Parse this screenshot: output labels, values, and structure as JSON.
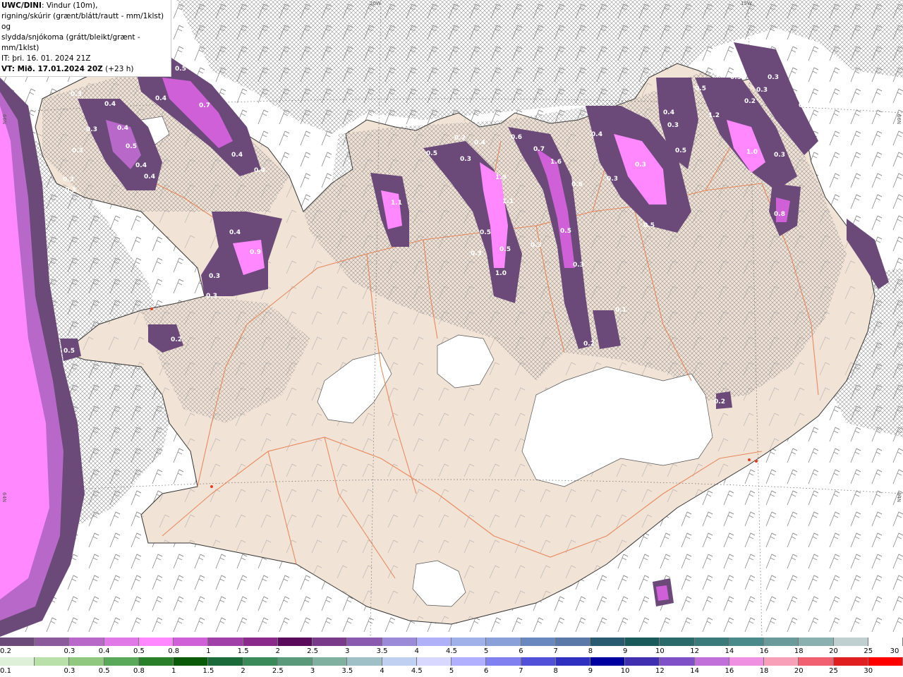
{
  "header": {
    "title_bold": "UWC/DINI",
    "title_rest": ": Vindur (10m),",
    "line2": "rigning/skúrir (grænt/blátt/rautt - mm/1klst) og",
    "line3": "slydda/snjókoma (grátt/bleikt/grænt - mm/1klst)",
    "line4": "IT: þri. 16. 01. 2024 21Z",
    "line5_bold": "VT: Mið. 17.01.2024 20Z",
    "line5_rest": " (+23 h)"
  },
  "grid_labels": {
    "lon_20w": "20W",
    "lon_15w": "15W",
    "lat_66n_left": "66N",
    "lat_66n_right": "66N",
    "lat_64n_left": "64N",
    "lat_64n_right": "64N"
  },
  "precip_labels": [
    "0.4",
    "0.5",
    "0.3",
    "0.4",
    "0.7",
    "0.4",
    "0.3",
    "0.4",
    "0.5",
    "0.4",
    "0.4",
    "0.3",
    "0.3",
    "0.3",
    "0.4",
    "0.4",
    "0.9",
    "0.4",
    "0.3",
    "0.2",
    "0.5",
    "1.1",
    "0.5",
    "0.2",
    "0.4",
    "0.3",
    "0.6",
    "0.7",
    "1.6",
    "1.9",
    "1.1",
    "0.5",
    "0.5",
    "1.0",
    "0.3",
    "0.3",
    "0.5",
    "0.6",
    "0.3",
    "0.4",
    "0.4",
    "0.3",
    "0.5",
    "1.2",
    "0.3",
    "0.3",
    "0.5",
    "0.2",
    "0.3",
    "1.0",
    "0.3",
    "0.3",
    "0.3",
    "0.8",
    "0.3",
    "0.3",
    "0.2",
    "0.1",
    "0.2",
    "0.5"
  ],
  "legend_snow": {
    "labels": [
      "0.2",
      "0.3",
      "0.4",
      "0.5",
      "0.8",
      "1",
      "1.5",
      "2",
      "2.5",
      "3",
      "3.5",
      "4",
      "4.5",
      "5",
      "6",
      "7",
      "8",
      "9",
      "10",
      "12",
      "14",
      "16",
      "18",
      "20",
      "25",
      "30"
    ],
    "colors": [
      "#6b4a7a",
      "#8a5a9a",
      "#b868c8",
      "#e078e8",
      "#ff88ff",
      "#d060d8",
      "#a040a8",
      "#8a2a8a",
      "#5a0a5a",
      "#7a3a8a",
      "#8a5ab0",
      "#9a8ad8",
      "#b0b0f8",
      "#a0b0e8",
      "#8aa0d8",
      "#6a88c0",
      "#5a78a8",
      "#2a5a70",
      "#1a5a5a",
      "#2a6a6a",
      "#3a7a7a",
      "#4a8a8a",
      "#6a9a9a",
      "#8ab0b0",
      "#c0d0d0",
      "#ffffff"
    ]
  },
  "legend_rain": {
    "labels": [
      "0.1",
      "0.3",
      "0.5",
      "0.8",
      "1",
      "1.5",
      "2",
      "2.5",
      "3",
      "3.5",
      "4",
      "4.5",
      "5",
      "6",
      "7",
      "8",
      "9",
      "10",
      "12",
      "14",
      "16",
      "18",
      "20",
      "25",
      "30"
    ],
    "colors": [
      "#dff0d8",
      "#b8e0a8",
      "#90c880",
      "#5aa85a",
      "#2a802a",
      "#0a5a0a",
      "#1a6a3a",
      "#3a8a5a",
      "#5a9a7a",
      "#80b0a0",
      "#a0c0c8",
      "#c0d0f0",
      "#d8d8ff",
      "#b0b0ff",
      "#8080f0",
      "#5050d8",
      "#3030c0",
      "#0000a0",
      "#4030b0",
      "#8050c8",
      "#c070d8",
      "#f090e0",
      "#f8a0b8",
      "#f06070",
      "#e02020",
      "#ff0000"
    ]
  }
}
